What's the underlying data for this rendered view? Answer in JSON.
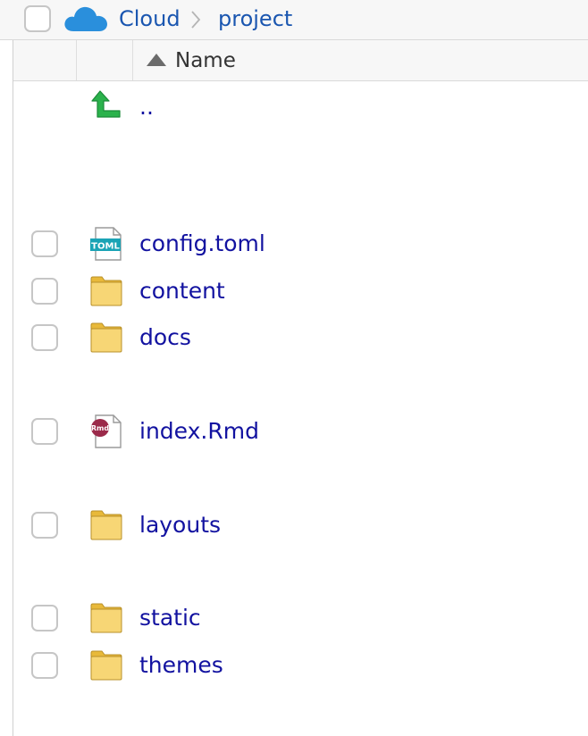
{
  "breadcrumb": {
    "items": [
      {
        "label": "Cloud"
      },
      {
        "label": "project"
      }
    ]
  },
  "columns": {
    "name_label": "Name",
    "sort_direction": "ascending"
  },
  "files": {
    "parent": {
      "name": ".."
    },
    "items": [
      {
        "name": "config.toml",
        "icon": "toml-file-icon"
      },
      {
        "name": "content",
        "icon": "folder-icon"
      },
      {
        "name": "docs",
        "icon": "folder-icon"
      },
      {
        "name": "index.Rmd",
        "icon": "rmd-file-icon"
      },
      {
        "name": "layouts",
        "icon": "folder-icon"
      },
      {
        "name": "static",
        "icon": "folder-icon"
      },
      {
        "name": "themes",
        "icon": "folder-icon"
      }
    ]
  },
  "colors": {
    "link": "#1212a0",
    "breadcrumb": "#1a56b0",
    "cloud": "#2a8fdc",
    "folder": "#f2c94c",
    "up_arrow": "#2bb24c",
    "rmd_badge": "#9b2a4a"
  }
}
